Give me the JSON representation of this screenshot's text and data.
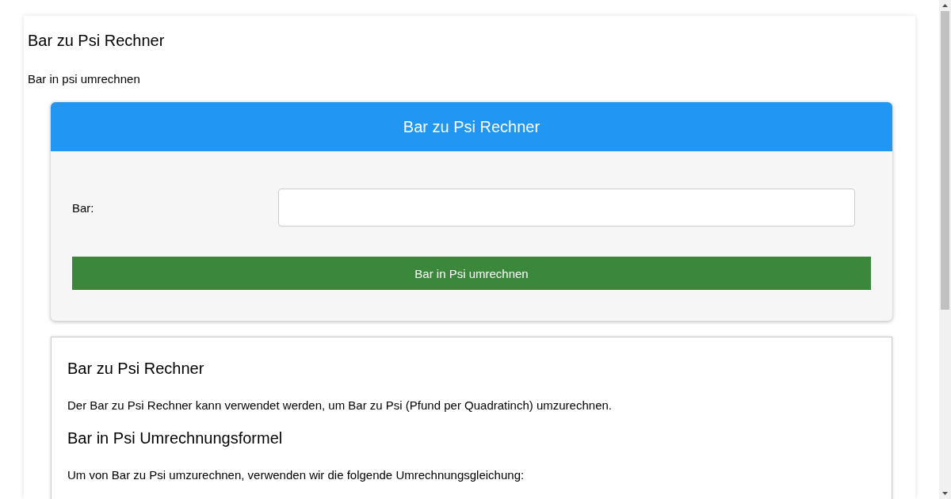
{
  "page": {
    "title": "Bar zu Psi Rechner",
    "subtitle": "Bar in psi umrechnen"
  },
  "calculator": {
    "header": "Bar zu Psi Rechner",
    "field_label": "Bar:",
    "button": "Bar in Psi umrechnen"
  },
  "article": [
    {
      "kind": "heading",
      "text": "Bar zu Psi Rechner"
    },
    {
      "kind": "paragraph",
      "text": "Der Bar zu Psi Rechner kann verwendet werden, um Bar zu Psi (Pfund per Quadratinch) umzurechnen."
    },
    {
      "kind": "heading",
      "text": "Bar in Psi Umrechnungsformel"
    },
    {
      "kind": "paragraph",
      "text": "Um von Bar zu Psi umzurechnen, verwenden wir die folgende Umrechnungsgleichung:"
    }
  ]
}
